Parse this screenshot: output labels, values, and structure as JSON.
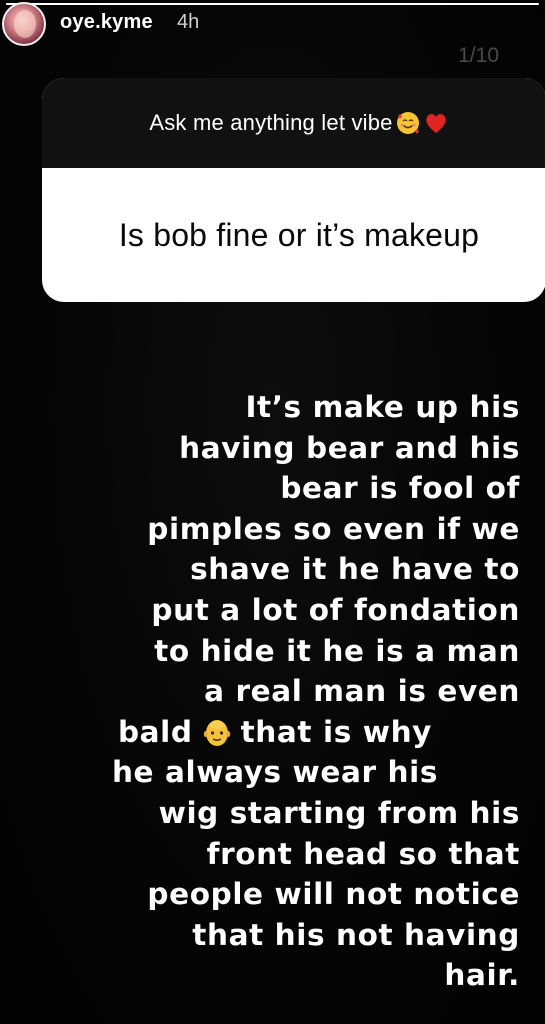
{
  "story": {
    "progress": 1.0,
    "username": "oye.kyme",
    "time": "4h",
    "counter": "1/10"
  },
  "question_sticker": {
    "prompt": "Ask me anything let vibe",
    "prompt_icons": [
      "smiling-face-with-hearts-icon",
      "red-heart-icon"
    ],
    "answer": "Is bob fine or it’s makeup"
  },
  "reply": {
    "lines": [
      "It’s make up his",
      "having bear and his",
      "bear is fool of",
      "pimples so even if we",
      "shave it he have to",
      "put a lot of fondation",
      "to hide it he is a man",
      "a real man is even",
      "he always wear his",
      "wig starting from his",
      "front head so that",
      "people will not notice",
      "that his not having",
      "hair."
    ],
    "bald_line": {
      "before": "bald",
      "icon": "bald-man-emoji-icon",
      "after": "that is why"
    }
  },
  "colors": {
    "background": "#050505",
    "card_header": "#111111",
    "card_body": "#ffffff",
    "text": "#ffffff"
  }
}
